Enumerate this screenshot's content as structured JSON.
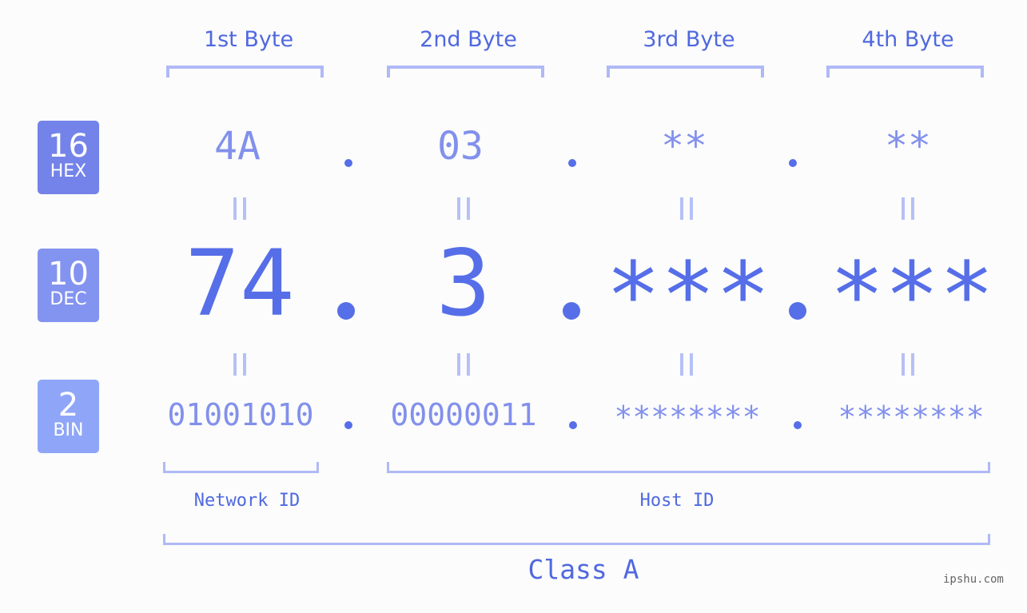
{
  "badges": [
    {
      "num": "16",
      "label": "HEX",
      "color": "#7383ea"
    },
    {
      "num": "10",
      "label": "DEC",
      "color": "#8393f0"
    },
    {
      "num": "2",
      "label": "BIN",
      "color": "#8fa6f8"
    }
  ],
  "bytes": [
    {
      "title": "1st Byte",
      "hex": "4A",
      "dec": "74",
      "bin": "01001010"
    },
    {
      "title": "2nd Byte",
      "hex": "03",
      "dec": "3",
      "bin": "00000011"
    },
    {
      "title": "3rd Byte",
      "hex": "**",
      "dec": "***",
      "bin": "********"
    },
    {
      "title": "4th Byte",
      "hex": "**",
      "dec": "***",
      "bin": "********"
    }
  ],
  "network_label": "Network ID",
  "host_label": "Host ID",
  "class_label": "Class A",
  "watermark": "ipshu.com",
  "colors": {
    "accent": "#566ee8",
    "light": "#8290ec",
    "bracket": "#b0b9f6"
  }
}
